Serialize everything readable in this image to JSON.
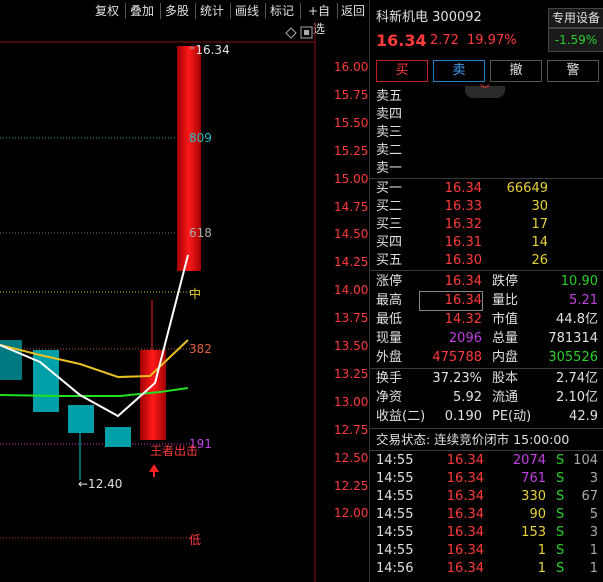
{
  "toolbar": {
    "items": [
      "复权",
      "叠加",
      "多股",
      "统计",
      "画线",
      "标记",
      "+自选",
      "返回"
    ]
  },
  "chart": {
    "y_axis_labels": [
      "16.00",
      "15.75",
      "15.50",
      "15.25",
      "15.00",
      "14.75",
      "14.50",
      "14.25",
      "14.00",
      "13.75",
      "13.50",
      "13.25",
      "13.00",
      "12.75",
      "12.50",
      "12.25",
      "12.00"
    ],
    "level_labels": {
      "top": "16.34",
      "l809": "809",
      "l618": "618",
      "mid": "中",
      "l382": "382",
      "l191": "191",
      "low": "低"
    },
    "min_label": "←12.40",
    "annotation": "王者出击",
    "colors": {
      "up": "#ff2020",
      "down": "#00c8c8",
      "ma_white": "#ffffff",
      "ma_yellow": "#e8c020",
      "ma_green": "#20e020"
    }
  },
  "stock": {
    "name": "科新机电",
    "code": "300092",
    "price": "16.34",
    "change": "2.72",
    "change_pct": "19.97%",
    "device_btn": "专用设备",
    "device_pct": "-1.59%"
  },
  "actions": [
    "买",
    "卖",
    "撤",
    "警"
  ],
  "sells": [
    {
      "label": "卖五",
      "price": "",
      "vol": ""
    },
    {
      "label": "卖四",
      "price": "",
      "vol": ""
    },
    {
      "label": "卖三",
      "price": "",
      "vol": ""
    },
    {
      "label": "卖二",
      "price": "",
      "vol": ""
    },
    {
      "label": "卖一",
      "price": "",
      "vol": ""
    }
  ],
  "buys": [
    {
      "label": "买一",
      "price": "16.34",
      "vol": "66649"
    },
    {
      "label": "买二",
      "price": "16.33",
      "vol": "30"
    },
    {
      "label": "买三",
      "price": "16.32",
      "vol": "17"
    },
    {
      "label": "买四",
      "price": "16.31",
      "vol": "14"
    },
    {
      "label": "买五",
      "price": "16.30",
      "vol": "26"
    }
  ],
  "stats": [
    {
      "l1": "涨停",
      "v1": "16.34",
      "l2": "跌停",
      "v2": "10.90"
    },
    {
      "l1": "最高",
      "v1": "16.34",
      "l2": "量比",
      "v2": "5.21"
    },
    {
      "l1": "最低",
      "v1": "14.32",
      "l2": "市值",
      "v2": "44.8亿"
    },
    {
      "l1": "现量",
      "v1": "2096",
      "l2": "总量",
      "v2": "781314"
    },
    {
      "l1": "外盘",
      "v1": "475788",
      "l2": "内盘",
      "v2": "305526"
    }
  ],
  "stats2": [
    {
      "l1": "换手",
      "v1": "37.23%",
      "l2": "股本",
      "v2": "2.74亿"
    },
    {
      "l1": "净资",
      "v1": "5.92",
      "l2": "流通",
      "v2": "2.10亿"
    },
    {
      "l1": "收益(二)",
      "v1": "0.190",
      "l2": "PE(动)",
      "v2": "42.9"
    }
  ],
  "trade_status": "交易状态: 连续竞价闭市 15:00:00",
  "ticks": [
    {
      "time": "14:55",
      "price": "16.34",
      "vol": "2074",
      "side": "S",
      "n": "104"
    },
    {
      "time": "14:55",
      "price": "16.34",
      "vol": "761",
      "side": "S",
      "n": "3"
    },
    {
      "time": "14:55",
      "price": "16.34",
      "vol": "330",
      "side": "S",
      "n": "67"
    },
    {
      "time": "14:55",
      "price": "16.34",
      "vol": "90",
      "side": "S",
      "n": "5"
    },
    {
      "time": "14:55",
      "price": "16.34",
      "vol": "153",
      "side": "S",
      "n": "3"
    },
    {
      "time": "14:55",
      "price": "16.34",
      "vol": "1",
      "side": "S",
      "n": "1"
    },
    {
      "time": "14:56",
      "price": "16.34",
      "vol": "1",
      "side": "S",
      "n": "1"
    }
  ]
}
